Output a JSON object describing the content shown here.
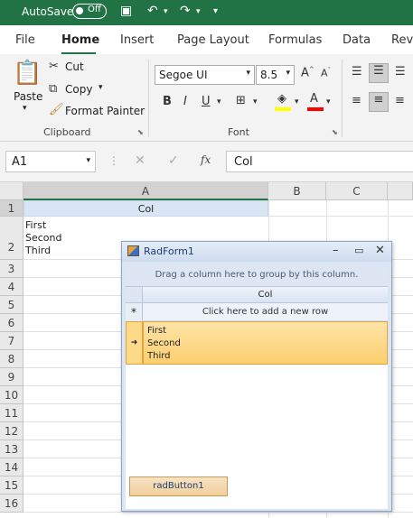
{
  "titlebar": {
    "autosave_label": "AutoSave",
    "autosave_state": "Off"
  },
  "tabs": [
    "File",
    "Home",
    "Insert",
    "Page Layout",
    "Formulas",
    "Data",
    "Rev"
  ],
  "clipboard": {
    "paste": "Paste",
    "cut": "Cut",
    "copy": "Copy",
    "format_painter": "Format Painter",
    "label": "Clipboard"
  },
  "font": {
    "name": "Segoe UI",
    "size": "8.5",
    "label": "Font",
    "bold": "B",
    "italic": "I",
    "underline": "U"
  },
  "formula_bar": {
    "name_box": "A1",
    "fx": "fx",
    "content": "Col"
  },
  "sheet": {
    "columns": [
      "A",
      "B",
      "C"
    ],
    "rows": [
      "1",
      "2",
      "3",
      "4",
      "5",
      "6",
      "7",
      "8",
      "9",
      "10",
      "11",
      "12",
      "13",
      "14",
      "15",
      "16"
    ],
    "a1": "Col",
    "a2_lines": [
      "First",
      "Second",
      "Third"
    ]
  },
  "radform": {
    "title": "RadForm1",
    "group_panel_text": "Drag a column here to group by this column.",
    "column_header": "Col",
    "new_row_text": "Click here to add a new row",
    "row_lines": [
      "First",
      "Second",
      "Third"
    ],
    "button_label": "radButton1"
  }
}
